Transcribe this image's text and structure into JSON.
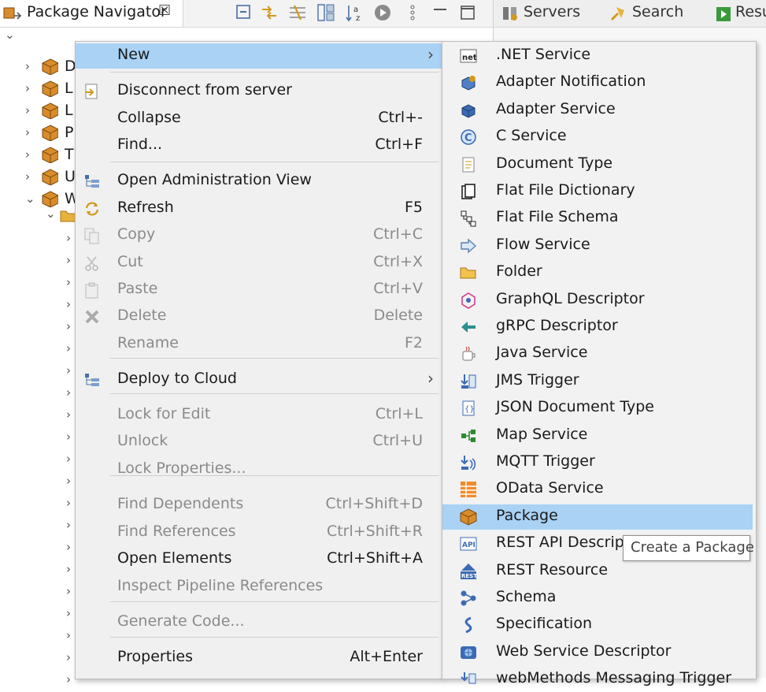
{
  "view_tab": {
    "title": "Package Navigator",
    "close": "☒"
  },
  "right_tabs": {
    "servers": "Servers",
    "search": "Search",
    "results": "Resu"
  },
  "tree": {
    "rows": [
      {
        "initial": "D"
      },
      {
        "initial": "L"
      },
      {
        "initial": "L"
      },
      {
        "initial": "P"
      },
      {
        "initial": "T"
      },
      {
        "initial": "U"
      },
      {
        "initial": "W"
      }
    ]
  },
  "context_menu": {
    "items": [
      {
        "label": "New",
        "accel": "",
        "submenu": true
      },
      {
        "label": "Disconnect from server",
        "accel": ""
      },
      {
        "label": "Collapse",
        "accel": "Ctrl+-"
      },
      {
        "label": "Find...",
        "accel": "Ctrl+F"
      },
      {
        "label": "Open Administration View",
        "accel": ""
      },
      {
        "label": "Refresh",
        "accel": "F5"
      },
      {
        "label": "Copy",
        "accel": "Ctrl+C",
        "disabled": true
      },
      {
        "label": "Cut",
        "accel": "Ctrl+X",
        "disabled": true
      },
      {
        "label": "Paste",
        "accel": "Ctrl+V",
        "disabled": true
      },
      {
        "label": "Delete",
        "accel": "Delete",
        "disabled": true
      },
      {
        "label": "Rename",
        "accel": "F2",
        "disabled": true
      },
      {
        "label": "Deploy to Cloud",
        "accel": "",
        "submenu": true
      },
      {
        "label": "Lock for Edit",
        "accel": "Ctrl+L",
        "disabled": true
      },
      {
        "label": "Unlock",
        "accel": "Ctrl+U",
        "disabled": true
      },
      {
        "label": "Lock Properties...",
        "accel": "",
        "disabled": true
      },
      {
        "label": "Find Dependents",
        "accel": "Ctrl+Shift+D",
        "disabled": true
      },
      {
        "label": "Find References",
        "accel": "Ctrl+Shift+R",
        "disabled": true
      },
      {
        "label": "Open Elements",
        "accel": "Ctrl+Shift+A"
      },
      {
        "label": "Inspect Pipeline References",
        "accel": "",
        "disabled": true
      },
      {
        "label": "Generate Code...",
        "accel": "",
        "disabled": true
      },
      {
        "label": "Properties",
        "accel": "Alt+Enter"
      }
    ],
    "arrow": "›"
  },
  "new_submenu": {
    "items": [
      {
        "label": ".NET Service",
        "icon": "dotnet-icon"
      },
      {
        "label": "Adapter Notification",
        "icon": "adapter-notification-icon"
      },
      {
        "label": "Adapter Service",
        "icon": "adapter-service-icon"
      },
      {
        "label": "C Service",
        "icon": "c-service-icon"
      },
      {
        "label": "Document Type",
        "icon": "document-type-icon"
      },
      {
        "label": "Flat File Dictionary",
        "icon": "flat-file-dictionary-icon"
      },
      {
        "label": "Flat File Schema",
        "icon": "flat-file-schema-icon"
      },
      {
        "label": "Flow Service",
        "icon": "flow-service-icon"
      },
      {
        "label": "Folder",
        "icon": "folder-icon"
      },
      {
        "label": "GraphQL Descriptor",
        "icon": "graphql-icon"
      },
      {
        "label": "gRPC Descriptor",
        "icon": "grpc-icon"
      },
      {
        "label": "Java Service",
        "icon": "java-service-icon"
      },
      {
        "label": "JMS Trigger",
        "icon": "jms-trigger-icon"
      },
      {
        "label": "JSON Document Type",
        "icon": "json-document-icon"
      },
      {
        "label": "Map Service",
        "icon": "map-service-icon"
      },
      {
        "label": "MQTT Trigger",
        "icon": "mqtt-trigger-icon"
      },
      {
        "label": "OData Service",
        "icon": "odata-service-icon"
      },
      {
        "label": "Package",
        "icon": "package-icon",
        "highlighted": true
      },
      {
        "label": "REST API Descripto",
        "icon": "rest-api-icon"
      },
      {
        "label": "REST Resource",
        "icon": "rest-resource-icon"
      },
      {
        "label": "Schema",
        "icon": "schema-icon"
      },
      {
        "label": "Specification",
        "icon": "specification-icon"
      },
      {
        "label": "Web Service Descriptor",
        "icon": "web-service-icon"
      },
      {
        "label": "webMethods Messaging Trigger",
        "icon": "messaging-trigger-icon"
      }
    ]
  },
  "tooltip": {
    "text": "Create a Package"
  },
  "colors": {
    "highlight": "#a9d2f5",
    "menu_bg": "#f0f0f0",
    "package_orange": "#d98c2b"
  }
}
